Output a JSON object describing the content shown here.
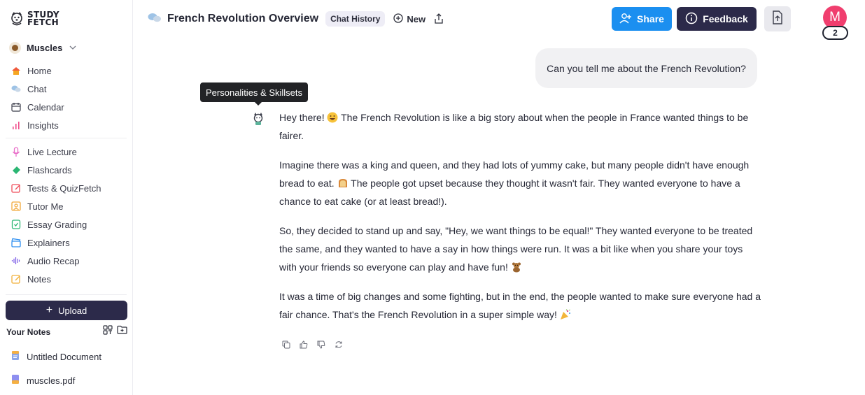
{
  "app": {
    "logo_line1": "STUDY",
    "logo_line2": "FETCH"
  },
  "sidebar": {
    "workspace": "Muscles",
    "nav_primary": [
      {
        "label": "Home",
        "icon": "house-icon"
      },
      {
        "label": "Chat",
        "icon": "chat-bubbles-icon"
      },
      {
        "label": "Calendar",
        "icon": "calendar-icon"
      },
      {
        "label": "Insights",
        "icon": "bar-chart-icon"
      }
    ],
    "nav_tools": [
      {
        "label": "Live Lecture",
        "icon": "microphone-icon"
      },
      {
        "label": "Flashcards",
        "icon": "flashcards-icon"
      },
      {
        "label": "Tests & QuizFetch",
        "icon": "pencil-square-icon"
      },
      {
        "label": "Tutor Me",
        "icon": "tutor-icon"
      },
      {
        "label": "Essay Grading",
        "icon": "check-document-icon"
      },
      {
        "label": "Explainers",
        "icon": "clapperboard-icon"
      },
      {
        "label": "Audio Recap",
        "icon": "waveform-icon"
      },
      {
        "label": "Notes",
        "icon": "notes-icon"
      }
    ],
    "upload_label": "Upload",
    "notes_heading": "Your Notes",
    "files": [
      {
        "label": "Untitled Document",
        "icon": "document-icon"
      },
      {
        "label": "muscles.pdf",
        "icon": "pdf-icon"
      }
    ]
  },
  "header": {
    "chat_title": "French Revolution Overview",
    "chat_history_label": "Chat History",
    "new_label": "New",
    "share_label": "Share",
    "feedback_label": "Feedback",
    "avatar_initial": "M",
    "avatar_badge": "2"
  },
  "chat": {
    "user_message": "Can you tell me about the French Revolution?",
    "tooltip": "Personalities & Skillsets",
    "bot_paragraphs": [
      {
        "text": "Hey there! ",
        "emoji": "grin-emoji",
        "text2": " The French Revolution is like a big story about when the people in France wanted things to be fairer."
      },
      {
        "text": "Imagine there was a king and queen, and they had lots of yummy cake, but many people didn't have enough bread to eat. ",
        "emoji": "bread-emoji",
        "text2": " The people got upset because they thought it wasn't fair. They wanted everyone to have a chance to eat cake (or at least bread!)."
      },
      {
        "text": "So, they decided to stand up and say, \"Hey, we want things to be equal!\" They wanted everyone to be treated the same, and they wanted to have a say in how things were run. It was a bit like when you share your toys with your friends so everyone can play and have fun! ",
        "emoji": "teddy-bear-emoji",
        "text2": ""
      },
      {
        "text": "It was a time of big changes and some fighting, but in the end, the people wanted to make sure everyone had a fair chance. That's the French Revolution in a super simple way! ",
        "emoji": "party-popper-emoji",
        "text2": ""
      }
    ]
  },
  "colors": {
    "primary_dark": "#2c2a4a",
    "share_blue": "#1b8ff0",
    "avatar_pink": "#f03e6e"
  }
}
